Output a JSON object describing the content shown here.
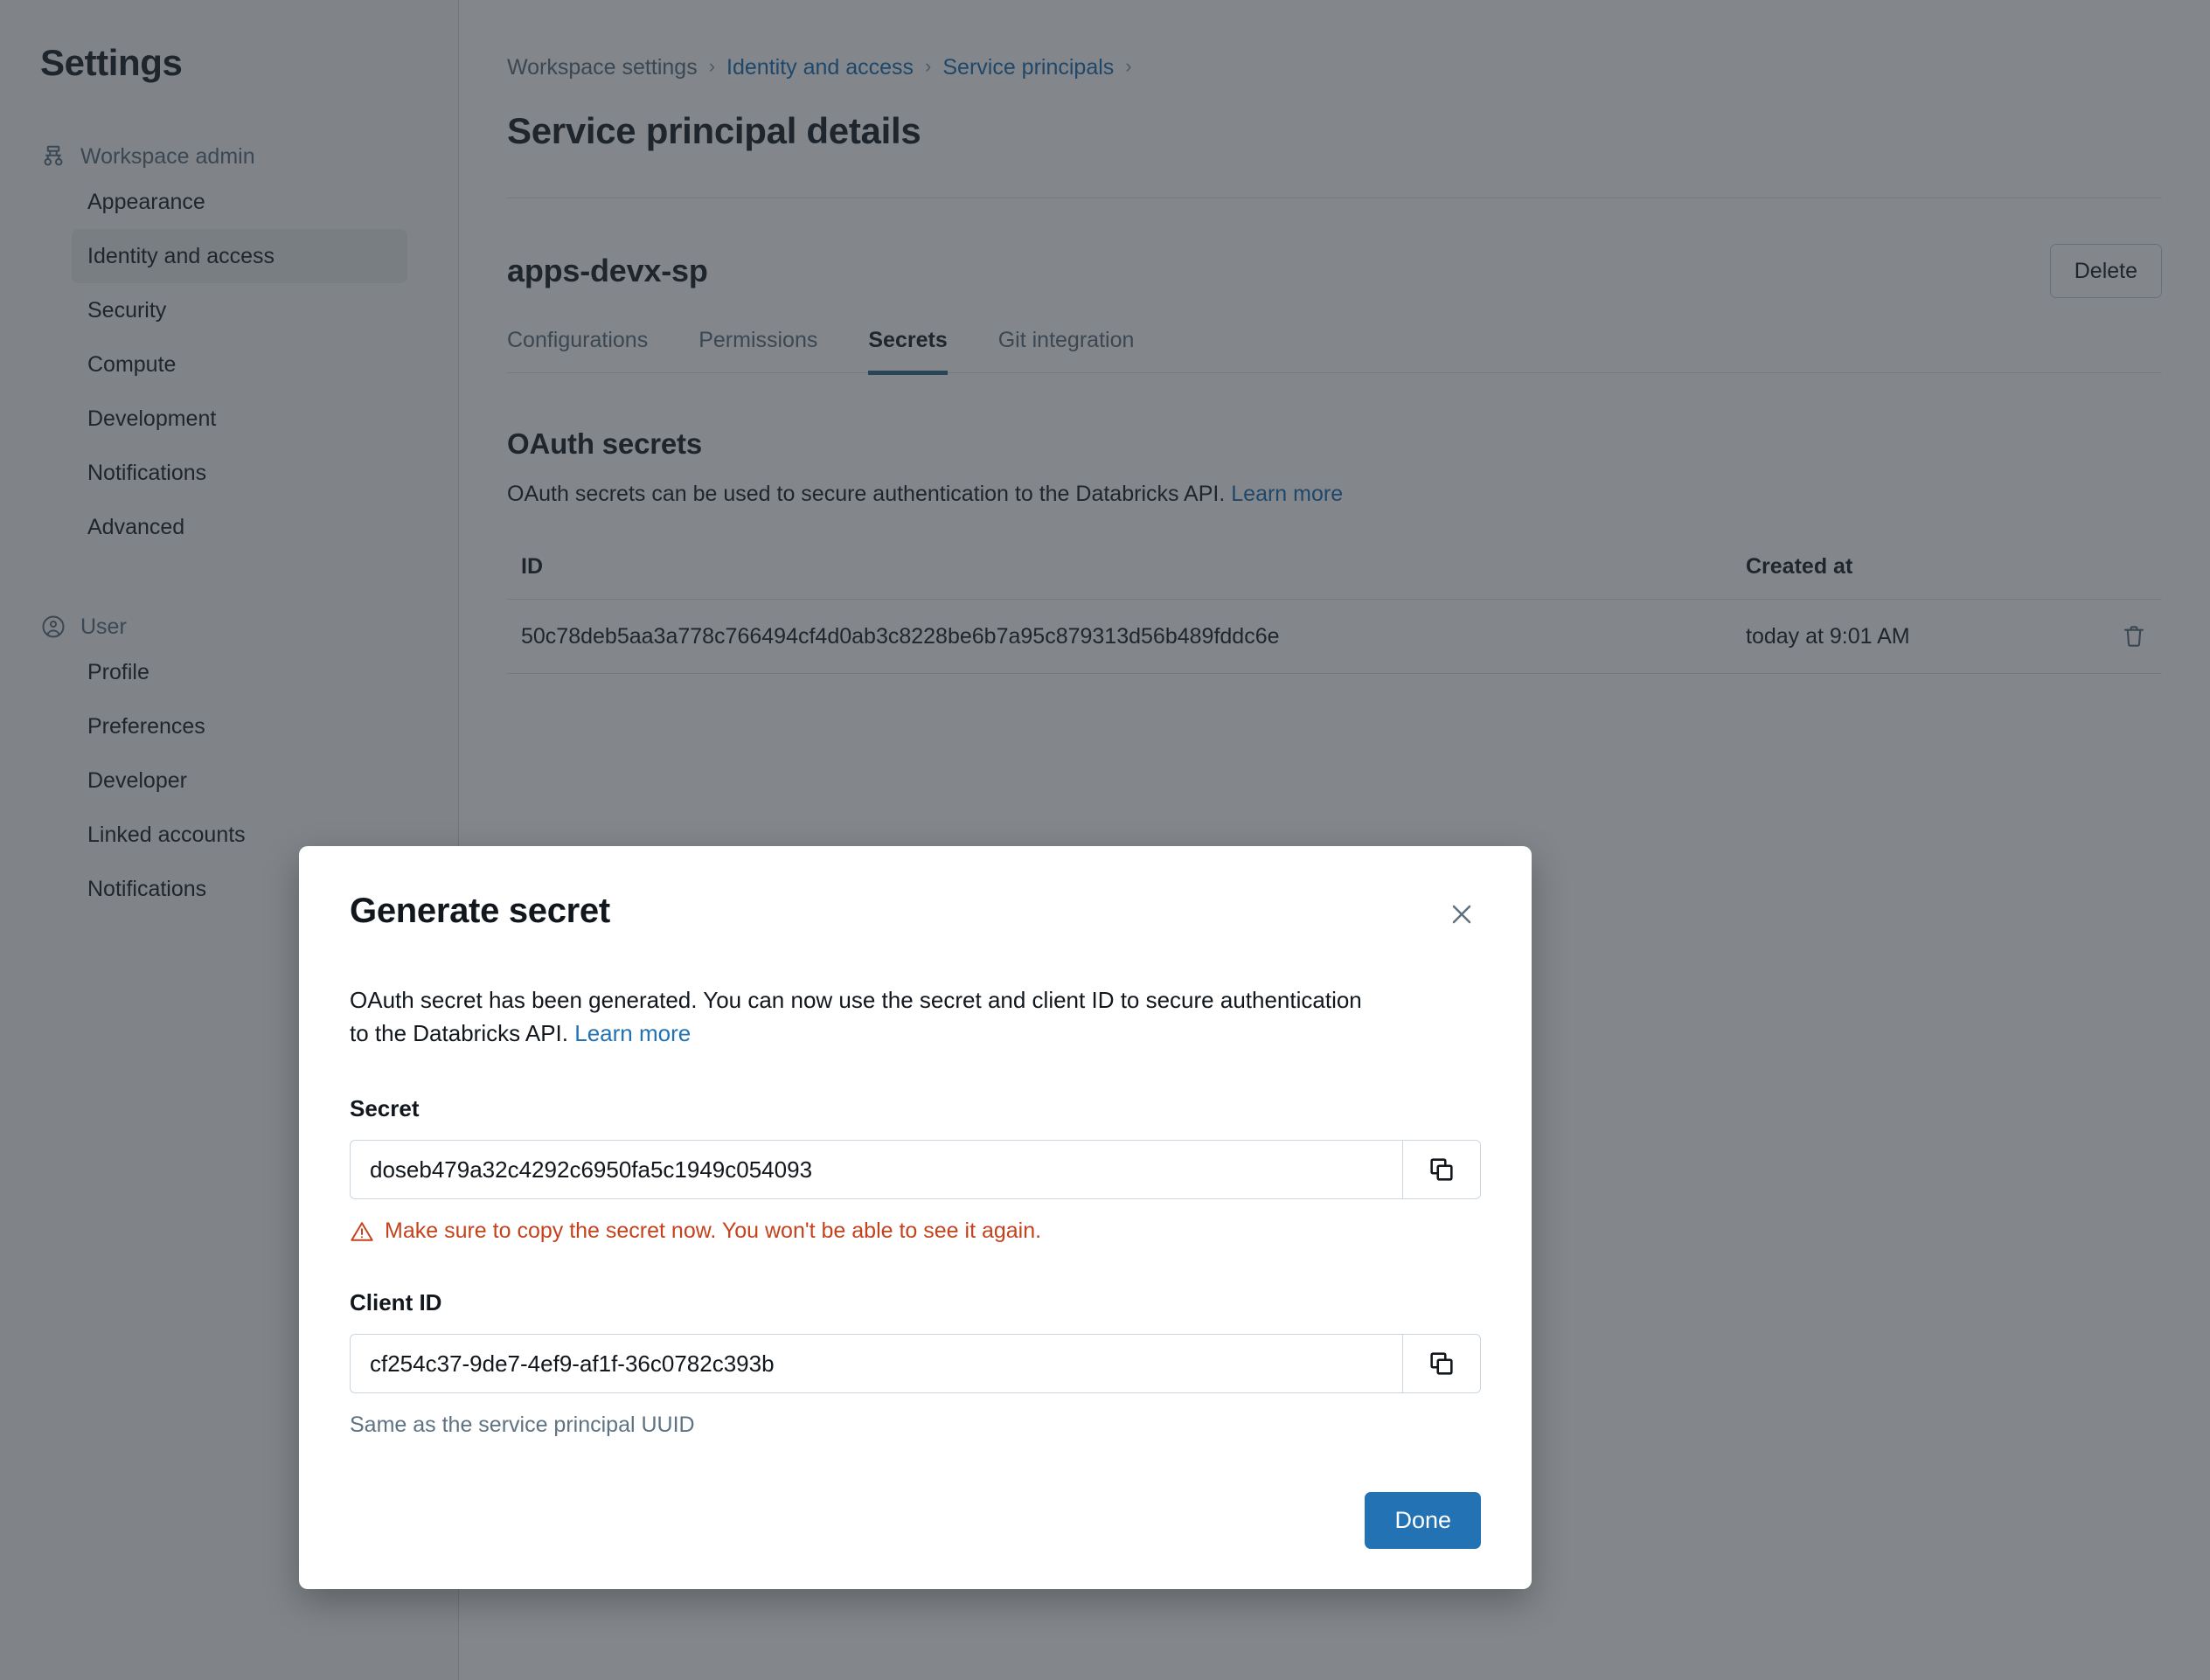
{
  "sidebar": {
    "title": "Settings",
    "groups": [
      {
        "icon": "workspace-admin-icon",
        "label": "Workspace admin",
        "items": [
          {
            "label": "Appearance",
            "active": false
          },
          {
            "label": "Identity and access",
            "active": true
          },
          {
            "label": "Security",
            "active": false
          },
          {
            "label": "Compute",
            "active": false
          },
          {
            "label": "Development",
            "active": false
          },
          {
            "label": "Notifications",
            "active": false
          },
          {
            "label": "Advanced",
            "active": false
          }
        ]
      },
      {
        "icon": "user-icon",
        "label": "User",
        "items": [
          {
            "label": "Profile",
            "active": false
          },
          {
            "label": "Preferences",
            "active": false
          },
          {
            "label": "Developer",
            "active": false
          },
          {
            "label": "Linked accounts",
            "active": false
          },
          {
            "label": "Notifications",
            "active": false
          }
        ]
      }
    ]
  },
  "main": {
    "breadcrumb": [
      {
        "label": "Workspace settings",
        "link": false
      },
      {
        "label": "Identity and access",
        "link": true
      },
      {
        "label": "Service principals",
        "link": true
      }
    ],
    "breadcrumb_separator": "›",
    "page_title": "Service principal details",
    "sp_name": "apps-devx-sp",
    "delete_label": "Delete",
    "tabs": [
      {
        "label": "Configurations",
        "active": false
      },
      {
        "label": "Permissions",
        "active": false
      },
      {
        "label": "Secrets",
        "active": true
      },
      {
        "label": "Git integration",
        "active": false
      }
    ],
    "section_title": "OAuth secrets",
    "section_desc": "OAuth secrets can be used to secure authentication to the Databricks API.",
    "section_link": "Learn more",
    "table": {
      "headers": {
        "id": "ID",
        "created_at": "Created at"
      },
      "rows": [
        {
          "id": "50c78deb5aa3a778c766494cf4d0ab3c8228be6b7a95c879313d56b489fddc6e",
          "created_at": "today at 9:01 AM",
          "delete_icon": "trash-icon"
        }
      ]
    }
  },
  "modal": {
    "title": "Generate secret",
    "close_icon": "close-icon",
    "body_text": "OAuth secret has been generated. You can now use the secret and client ID to secure authentication to the Databricks API.",
    "body_link": "Learn more",
    "secret": {
      "label": "Secret",
      "value": "doseb479a32c4292c6950fa5c1949c054093",
      "copy_icon": "copy-icon",
      "warning_icon": "warning-triangle-icon",
      "warning_text": "Make sure to copy the secret now. You won't be able to see it again."
    },
    "client_id": {
      "label": "Client ID",
      "value": "cf254c37-9de7-4ef9-af1f-36c0782c393b",
      "copy_icon": "copy-icon",
      "help_text": "Same as the service principal UUID"
    },
    "done_label": "Done"
  },
  "colors": {
    "accent": "#2272b4",
    "link": "#2272b4",
    "warning": "#c4431d",
    "tab_underline": "#3b6e8f",
    "text": "#1f272d",
    "muted": "#5f7281"
  }
}
